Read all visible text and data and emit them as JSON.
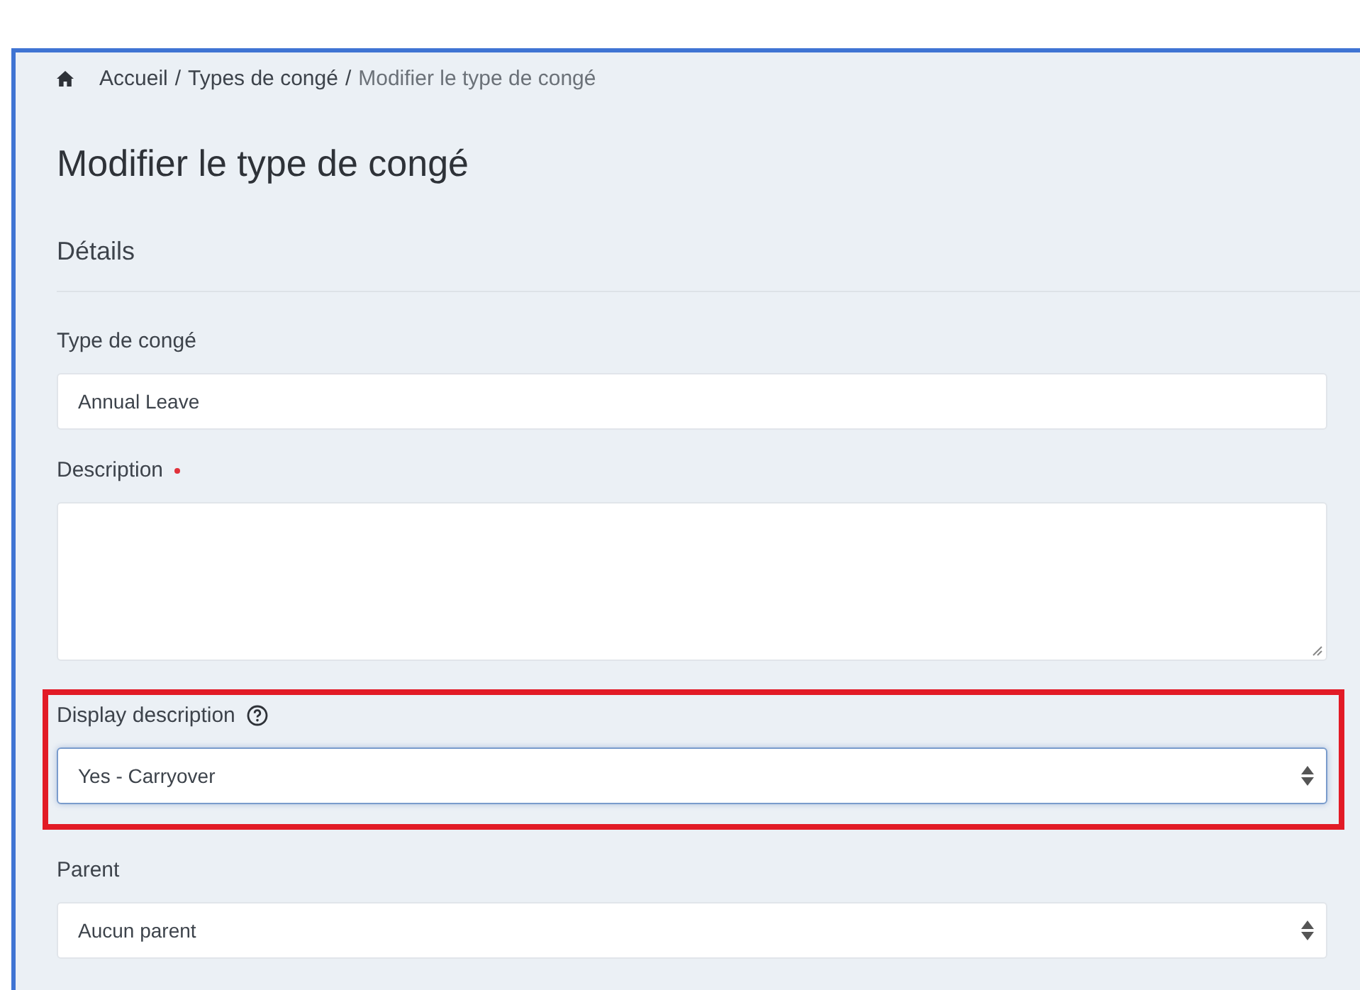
{
  "breadcrumb": [
    "Accueil",
    "Types de congé",
    "Modifier le type de congé"
  ],
  "breadcrumb_separator": "/",
  "title": "Modifier le type de congé",
  "section": "Détails",
  "fields": [
    {
      "kind": "text",
      "label": "Type de congé",
      "value": "Annual Leave",
      "focused": false,
      "highlighted": false
    },
    {
      "kind": "textarea",
      "label": "Description",
      "required": true,
      "focused": false,
      "highlighted": false
    },
    {
      "kind": "select",
      "label": "Display description",
      "value": "Yes - Carryover",
      "help": true,
      "focused": true,
      "highlighted": true
    },
    {
      "kind": "select",
      "label": "Parent",
      "value": "Aucun parent",
      "focused": false,
      "highlighted": false
    }
  ]
}
